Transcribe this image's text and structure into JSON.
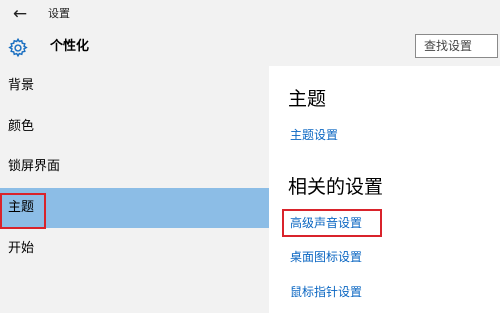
{
  "titlebar": {
    "back_icon": "arrow-left-icon",
    "title": "设置"
  },
  "header": {
    "icon": "gear-icon",
    "title": "个性化",
    "search_placeholder": "查找设置"
  },
  "sidebar": {
    "items": [
      {
        "label": "背景",
        "selected": false
      },
      {
        "label": "颜色",
        "selected": false
      },
      {
        "label": "锁屏界面",
        "selected": false
      },
      {
        "label": "主题",
        "selected": true
      },
      {
        "label": "开始",
        "selected": false
      }
    ]
  },
  "main": {
    "section1_title": "主题",
    "section1_link": "主题设置",
    "section2_title": "相关的设置",
    "related_links": [
      "高级声音设置",
      "桌面图标设置",
      "鼠标指针设置"
    ]
  },
  "colors": {
    "accent": "#8cbde6",
    "link": "#0a66c2",
    "highlight_border": "#d9232b",
    "panel_bg": "#f2f2f2"
  }
}
